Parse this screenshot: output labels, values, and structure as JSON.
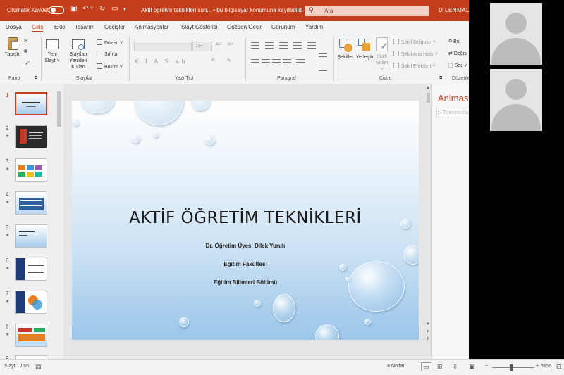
{
  "titlebar": {
    "autosave_label": "Otomatik Kaydet",
    "document_title": "Aktif öğretim teknikleri sun... • bu bilgisayar konumuna kaydedildi ˅",
    "search_placeholder": "Ara",
    "user_name": "D LENMAL"
  },
  "menu": {
    "items": [
      "Dosya",
      "Giriş",
      "Ekle",
      "Tasarım",
      "Geçişler",
      "Animasyonlar",
      "Slayt Gösterisi",
      "Gözden Geçir",
      "Görünüm",
      "Yardım"
    ],
    "active_index": 1
  },
  "ribbon": {
    "pano": {
      "paste_label": "Yapıştır",
      "group_label": "Pano"
    },
    "slaytlar": {
      "new_slide_label": "Yeni Slayt ˅",
      "reuse_label": "Slaytları Yeniden Kullan",
      "layout_label": "Düzen ˅",
      "reset_label": "Sıfırla",
      "section_label": "Bölüm ˅",
      "group_label": "Slaytlar"
    },
    "yazi_tipi": {
      "size_value": "18+",
      "format_buttons": "K  İ  A  S  ab",
      "group_label": "Yazı Tipi"
    },
    "paragraf": {
      "group_label": "Paragraf"
    },
    "cizim": {
      "shapes_label": "Şekiller",
      "arrange_label": "Yerleştir",
      "quick_styles_label": "Hızlı Stiller ˅",
      "fill_label": "Şekil Dolgusu ˅",
      "outline_label": "Şekil Ana Hattı ˅",
      "effects_label": "Şekil Efektleri ˅",
      "group_label": "Çizim"
    },
    "duzenleme": {
      "find_label": "Bul",
      "replace_label": "Değiş",
      "select_label": "Seç ˅",
      "group_label": "Düzenle"
    }
  },
  "thumbnails": {
    "items": [
      {
        "num": "1"
      },
      {
        "num": "2"
      },
      {
        "num": "3"
      },
      {
        "num": "4"
      },
      {
        "num": "5"
      },
      {
        "num": "6"
      },
      {
        "num": "7"
      },
      {
        "num": "8"
      },
      {
        "num": "9"
      }
    ],
    "active_index": 0,
    "star": "★"
  },
  "slide": {
    "title": "AKTİF ÖĞRETİM TEKNİKLERİ",
    "lines": [
      "Dr. Öğretim Üyesi Dilek Yurulı",
      "Eğitim Fakültesi",
      "Eğitim Bilimleri Bölümü"
    ]
  },
  "animation_pane": {
    "title": "Animasyon",
    "play_label": "▷ Tümünü Oynat"
  },
  "statusbar": {
    "slide_counter": "Slayt 1 / 65",
    "notes_label": "Notlar",
    "zoom_percent": "%56"
  }
}
